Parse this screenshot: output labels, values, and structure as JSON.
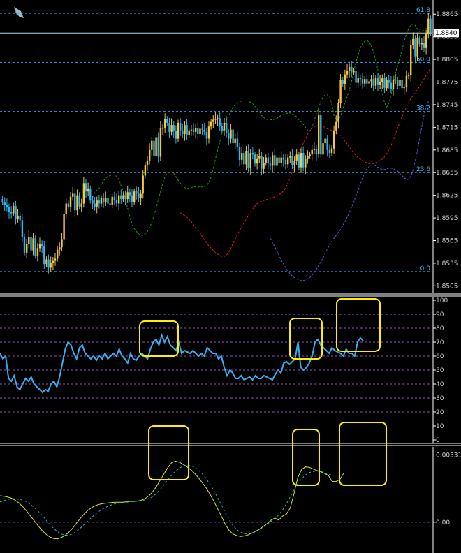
{
  "colors": {
    "background": "#000000",
    "candle_up": "#f6c744",
    "candle_down": "#33b4f2",
    "bb_upper": "#1e9b1e",
    "bb_middle": "#e01a1a",
    "bb_lower": "#4d5fd8",
    "fib_line": "#1aa8e8",
    "current_price_line": "#b0d8ef",
    "rsi_line": "#36aef0",
    "rsi_levels": "#8a4fc0",
    "macd_main": "#d6e81e",
    "macd_signal": "#22b4b4",
    "highlight": "#ffee00",
    "separator": "#ffffff"
  },
  "chart_data": [
    {
      "type": "candlestick",
      "panel": "price",
      "instrument_icon": "diamond-icon",
      "y_ticks": [
        "1.8865",
        "1.8835",
        "1.8805",
        "1.8775",
        "1.8745",
        "1.8715",
        "1.8685",
        "1.8655",
        "1.8625",
        "1.8595",
        "1.8565",
        "1.8535",
        "1.8505"
      ],
      "y_tick_values": [
        1.8865,
        1.8835,
        1.8805,
        1.8775,
        1.8745,
        1.8715,
        1.8685,
        1.8655,
        1.8625,
        1.8595,
        1.8565,
        1.8535,
        1.8505
      ],
      "ylim": [
        1.8497,
        1.888
      ],
      "current_price": 1.884,
      "current_price_label": "1.8840",
      "fibonacci": [
        {
          "label": "61.8",
          "price": 1.8866
        },
        {
          "label": "50.0",
          "price": 1.8801
        },
        {
          "label": "38.2",
          "price": 1.8736
        },
        {
          "label": "23.6",
          "price": 1.8655
        },
        {
          "label": "0.0",
          "price": 1.8524
        }
      ],
      "close": [
        1.8616,
        1.8612,
        1.8609,
        1.8603,
        1.8601,
        1.8611,
        1.8594,
        1.8598,
        1.8592,
        1.857,
        1.8549,
        1.856,
        1.857,
        1.8552,
        1.8568,
        1.8545,
        1.8555,
        1.856,
        1.8557,
        1.8534,
        1.854,
        1.8529,
        1.8535,
        1.8538,
        1.8541,
        1.8553,
        1.8556,
        1.8566,
        1.86,
        1.8614,
        1.861,
        1.8623,
        1.8627,
        1.8605,
        1.8625,
        1.861,
        1.8614,
        1.8641,
        1.863,
        1.8634,
        1.8618,
        1.8614,
        1.861,
        1.8618,
        1.8614,
        1.8621,
        1.8616,
        1.8621,
        1.8614,
        1.8612,
        1.8623,
        1.8619,
        1.8614,
        1.8625,
        1.862,
        1.8625,
        1.862,
        1.8629,
        1.8625,
        1.8616,
        1.863,
        1.8627,
        1.8621,
        1.8627,
        1.8651,
        1.8665,
        1.8671,
        1.8685,
        1.8697,
        1.8677,
        1.8702,
        1.8676,
        1.8714,
        1.8714,
        1.8726,
        1.8721,
        1.8709,
        1.8718,
        1.871,
        1.87,
        1.8721,
        1.8711,
        1.8706,
        1.8718,
        1.8705,
        1.8711,
        1.8712,
        1.8709,
        1.8714,
        1.8706,
        1.8713,
        1.8712,
        1.8709,
        1.87,
        1.8716,
        1.8722,
        1.8725,
        1.8726,
        1.8727,
        1.8717,
        1.8711,
        1.8721,
        1.8707,
        1.87,
        1.8712,
        1.8694,
        1.87,
        1.8689,
        1.8672,
        1.8681,
        1.8666,
        1.8684,
        1.8661,
        1.8681,
        1.8679,
        1.8667,
        1.8673,
        1.8677,
        1.866,
        1.8668,
        1.8675,
        1.8667,
        1.8664,
        1.8678,
        1.8664,
        1.8675,
        1.8668,
        1.8675,
        1.8672,
        1.8666,
        1.8675,
        1.8677,
        1.8665,
        1.8671,
        1.8679,
        1.8662,
        1.8681,
        1.8662,
        1.8673,
        1.8677,
        1.8679,
        1.8685,
        1.8686,
        1.868,
        1.8732,
        1.8679,
        1.8694,
        1.87,
        1.8685,
        1.8681,
        1.8687,
        1.8711,
        1.8722,
        1.8747,
        1.8778,
        1.8772,
        1.8785,
        1.879,
        1.8795,
        1.8788,
        1.879,
        1.8774,
        1.878,
        1.8779,
        1.8773,
        1.8779,
        1.8773,
        1.8776,
        1.8779,
        1.877,
        1.878,
        1.8771,
        1.8775,
        1.878,
        1.8767,
        1.8778,
        1.8774,
        1.8766,
        1.8778,
        1.8778,
        1.877,
        1.8778,
        1.8767,
        1.8768,
        1.8783,
        1.8784,
        1.8824,
        1.8832,
        1.8809,
        1.8833,
        1.8825,
        1.8827,
        1.882,
        1.8839,
        1.8859,
        1.884
      ],
      "bb_upper": [
        1.8622,
        1.8629,
        1.8632,
        1.8634,
        1.8639,
        1.8644,
        1.8648,
        1.865,
        1.8651,
        1.8652,
        1.8652,
        1.865,
        1.8646,
        1.8638,
        1.863,
        1.8619,
        1.8608,
        1.8597,
        1.8587,
        1.8581,
        1.8577,
        1.8574,
        1.8572,
        1.8572,
        1.8574,
        1.8577,
        1.8582,
        1.8589,
        1.8598,
        1.8608,
        1.8619,
        1.863,
        1.8641,
        1.8649,
        1.8654,
        1.8656,
        1.8656,
        1.8654,
        1.865,
        1.8645,
        1.8641,
        1.8637,
        1.8635,
        1.8634,
        1.8634,
        1.8635,
        1.8636,
        1.8636,
        1.8636,
        1.8636,
        1.8636,
        1.8636,
        1.8638,
        1.8642,
        1.8649,
        1.866,
        1.8673,
        1.8685,
        1.8696,
        1.8707,
        1.8716,
        1.8724,
        1.873,
        1.8736,
        1.8741,
        1.8745,
        1.8747,
        1.8749,
        1.875,
        1.875,
        1.875,
        1.875,
        1.8748,
        1.8746,
        1.8743,
        1.874,
        1.8736,
        1.8731,
        1.8728,
        1.8726,
        1.8725,
        1.8725,
        1.8725,
        1.8726,
        1.8727,
        1.8729,
        1.8731,
        1.8732,
        1.8733,
        1.8734,
        1.8734,
        1.8733,
        1.8731,
        1.8729,
        1.8725,
        1.8722,
        1.8719,
        1.8715,
        1.8711,
        1.871,
        1.8715,
        1.8724,
        1.8733,
        1.8741,
        1.8749,
        1.8755,
        1.8758,
        1.8758,
        1.8755,
        1.8746,
        1.8731,
        1.8725,
        1.8725,
        1.873,
        1.8739,
        1.8748,
        1.8756,
        1.8764,
        1.8776,
        1.8789,
        1.8801,
        1.8811,
        1.882,
        1.8826,
        1.8829,
        1.883,
        1.8828,
        1.8823,
        1.8815,
        1.8804,
        1.8791,
        1.8776,
        1.876,
        1.8748,
        1.8742,
        1.8747,
        1.8758,
        1.8772,
        1.8787,
        1.8797,
        1.8807,
        1.8818,
        1.8829,
        1.8839,
        1.8846,
        1.885,
        1.8852,
        1.885,
        1.8845,
        1.8842,
        1.8842,
        1.8844,
        1.8846,
        1.8847,
        1.8847
      ],
      "bb_middle": [
        1.8602,
        1.86,
        1.8598,
        1.8596,
        1.8593,
        1.859,
        1.8586,
        1.8582,
        1.8578,
        1.8575,
        1.857,
        1.8566,
        1.8562,
        1.8558,
        1.8555,
        1.8552,
        1.8549,
        1.8547,
        1.8545,
        1.8544,
        1.8544,
        1.8546,
        1.8549,
        1.8555,
        1.8561,
        1.8567,
        1.8573,
        1.8578,
        1.8583,
        1.8588,
        1.8593,
        1.8598,
        1.8603,
        1.8607,
        1.8611,
        1.8614,
        1.8616,
        1.8617,
        1.8618,
        1.8619,
        1.862,
        1.8621,
        1.8622,
        1.8623,
        1.8624,
        1.8626,
        1.8628,
        1.8631,
        1.8635,
        1.8641,
        1.8648,
        1.8656,
        1.8664,
        1.8672,
        1.868,
        1.8687,
        1.8694,
        1.87,
        1.8706,
        1.8711,
        1.8714,
        1.8716,
        1.8717,
        1.8717,
        1.8717,
        1.8716,
        1.8715,
        1.8713,
        1.8712,
        1.8711,
        1.871,
        1.8708,
        1.8706,
        1.8704,
        1.8701,
        1.8697,
        1.8693,
        1.8689,
        1.8685,
        1.8681,
        1.8678,
        1.8675,
        1.8673,
        1.8671,
        1.8669,
        1.8668,
        1.8667,
        1.8667,
        1.8667,
        1.8668,
        1.8669,
        1.8671,
        1.8673,
        1.8676,
        1.868,
        1.8685,
        1.8691,
        1.8698,
        1.8706,
        1.8714,
        1.8722,
        1.8729,
        1.8736,
        1.8742,
        1.8748,
        1.8753,
        1.8757,
        1.8761,
        1.8765,
        1.8769,
        1.8774,
        1.8779,
        1.8784,
        1.8789,
        1.8793
      ],
      "bb_lower": [
        1.8568,
        1.8562,
        1.8557,
        1.8551,
        1.8545,
        1.8539,
        1.8534,
        1.8529,
        1.8525,
        1.8521,
        1.8518,
        1.8516,
        1.8514,
        1.8513,
        1.8512,
        1.8512,
        1.8513,
        1.8514,
        1.8516,
        1.8519,
        1.8523,
        1.8527,
        1.8532,
        1.8537,
        1.8542,
        1.8548,
        1.8554,
        1.8559,
        1.8564,
        1.8568,
        1.8572,
        1.8576,
        1.858,
        1.8585,
        1.859,
        1.8596,
        1.8602,
        1.8609,
        1.8616,
        1.8624,
        1.8632,
        1.864,
        1.8648,
        1.8655,
        1.866,
        1.8663,
        1.8665,
        1.8665,
        1.8664,
        1.8662,
        1.866,
        1.8659,
        1.8659,
        1.866,
        1.8661,
        1.8661,
        1.866,
        1.8659,
        1.8657,
        1.8654,
        1.8651,
        1.8648,
        1.8646,
        1.8646,
        1.865,
        1.8658,
        1.867,
        1.8684,
        1.87,
        1.8716,
        1.8731,
        1.8743,
        1.8749,
        1.8747
      ]
    },
    {
      "type": "line",
      "panel": "rsi",
      "y_ticks": [
        "100",
        "90",
        "80",
        "70",
        "60",
        "50",
        "40",
        "30",
        "20",
        "10",
        "0"
      ],
      "y_tick_values": [
        100,
        90,
        80,
        70,
        60,
        50,
        40,
        30,
        20,
        10,
        0
      ],
      "ylim": [
        0,
        100
      ],
      "levels": [
        90,
        80,
        70,
        60,
        50,
        40,
        30,
        20
      ],
      "values": [
        62,
        58,
        60,
        44,
        42,
        46,
        38,
        36,
        40,
        44,
        42,
        45,
        40,
        38,
        36,
        34,
        36,
        35,
        40,
        42,
        38,
        45,
        55,
        65,
        70,
        68,
        62,
        58,
        66,
        68,
        62,
        60,
        58,
        60,
        57,
        60,
        58,
        62,
        58,
        60,
        62,
        60,
        65,
        60,
        58,
        55,
        62,
        58,
        57,
        60,
        62,
        60,
        58,
        65,
        70,
        72,
        68,
        75,
        70,
        74,
        68,
        66,
        64,
        70,
        62,
        64,
        63,
        62,
        64,
        62,
        60,
        62,
        60,
        66,
        64,
        62,
        62,
        58,
        60,
        52,
        46,
        50,
        48,
        44,
        44,
        46,
        43,
        44,
        45,
        43,
        46,
        44,
        44,
        46,
        45,
        44,
        43,
        47,
        50,
        48,
        55,
        56,
        54,
        56,
        58,
        70,
        52,
        50,
        52,
        55,
        60,
        70,
        72,
        68,
        66,
        64,
        62,
        66,
        64,
        63,
        62,
        60,
        65,
        62,
        62,
        60,
        70,
        73,
        71
      ]
    },
    {
      "type": "line",
      "panel": "macd",
      "y_ticks": [
        "0.00331",
        "0.00"
      ],
      "y_tick_values": [
        0.00331,
        0
      ],
      "ylim": [
        -0.00145,
        0.0035
      ],
      "series": [
        {
          "name": "",
          "role": "main",
          "values": [
            0.0013,
            0.00128,
            0.00124,
            0.00118,
            0.00108,
            0.00094,
            0.00076,
            0.00054,
            0.0003,
            6e-05,
            -0.00018,
            -0.0004,
            -0.00058,
            -0.00072,
            -0.0008,
            -0.00082,
            -0.00076,
            -0.00066,
            -0.0005,
            -0.0003,
            -6e-05,
            0.00018,
            0.0004,
            0.00058,
            0.00072,
            0.00082,
            0.00088,
            0.00092,
            0.00094,
            0.00096,
            0.00098,
            0.00098,
            0.00098,
            0.001,
            0.00102,
            0.00102,
            0.00104,
            0.00108,
            0.00116,
            0.0013,
            0.0015,
            0.00176,
            0.00208,
            0.0024,
            0.0027,
            0.00294,
            0.003,
            0.00295,
            0.00284,
            0.00272,
            0.00258,
            0.0024,
            0.00218,
            0.00194,
            0.00168,
            0.00138,
            0.00104,
            0.00066,
            0.00028,
            -0.0001,
            -0.0004,
            -0.00058,
            -0.00066,
            -0.0007,
            -0.00068,
            -0.00062,
            -0.00054,
            -0.00044,
            -0.00034,
            -0.0002,
            -6e-05,
            0.0001,
            0.0002,
            0.0001,
            0.0003,
            0.0004,
            0.0007,
            0.0014,
            0.0022,
            0.0026,
            0.00272,
            0.0027,
            0.00262,
            0.00254,
            0.00248,
            0.0024,
            0.0023,
            0.002,
            0.002,
            0.0021,
            0.0024
          ]
        },
        {
          "name": "",
          "role": "signal",
          "values": [
            0.001,
            0.00106,
            0.00112,
            0.00115,
            0.00116,
            0.00113,
            0.00108,
            0.001,
            0.00088,
            0.00072,
            0.00054,
            0.00034,
            0.00012,
            -0.0001,
            -0.0003,
            -0.00046,
            -0.00058,
            -0.00064,
            -0.00064,
            -0.00058,
            -0.00046,
            -0.0003,
            -0.00012,
            6e-05,
            0.00024,
            0.0004,
            0.00054,
            0.00066,
            0.00076,
            0.00084,
            0.0009,
            0.00094,
            0.00096,
            0.00098,
            0.001,
            0.00102,
            0.00104,
            0.00106,
            0.0011,
            0.00116,
            0.00126,
            0.00142,
            0.00162,
            0.00186,
            0.0021,
            0.00232,
            0.00252,
            0.00266,
            0.00276,
            0.0028,
            0.00278,
            0.0027,
            0.00256,
            0.00238,
            0.00214,
            0.00186,
            0.00156,
            0.0012,
            0.00084,
            0.00046,
            0.00012,
            -0.00016,
            -0.00036,
            -0.0005,
            -0.00056,
            -0.00058,
            -0.00054,
            -0.00046,
            -0.00036,
            -0.00024,
            -0.0001,
            4e-05,
            0.00018,
            0.00036,
            0.0006,
            0.0009,
            0.00124,
            0.0016,
            0.0019,
            0.00214,
            0.00232,
            0.00244,
            0.0025,
            0.00252,
            0.0025,
            0.00244,
            0.00236,
            0.00232,
            0.0023,
            0.00232,
            0.00236
          ]
        }
      ]
    }
  ],
  "highlights": [
    {
      "panel": "rsi",
      "label": "rsi-highlight-1"
    },
    {
      "panel": "rsi",
      "label": "rsi-highlight-2"
    },
    {
      "panel": "rsi",
      "label": "rsi-highlight-3"
    },
    {
      "panel": "macd",
      "label": "macd-highlight-1"
    },
    {
      "panel": "macd",
      "label": "macd-highlight-2"
    },
    {
      "panel": "macd",
      "label": "macd-highlight-3"
    }
  ]
}
